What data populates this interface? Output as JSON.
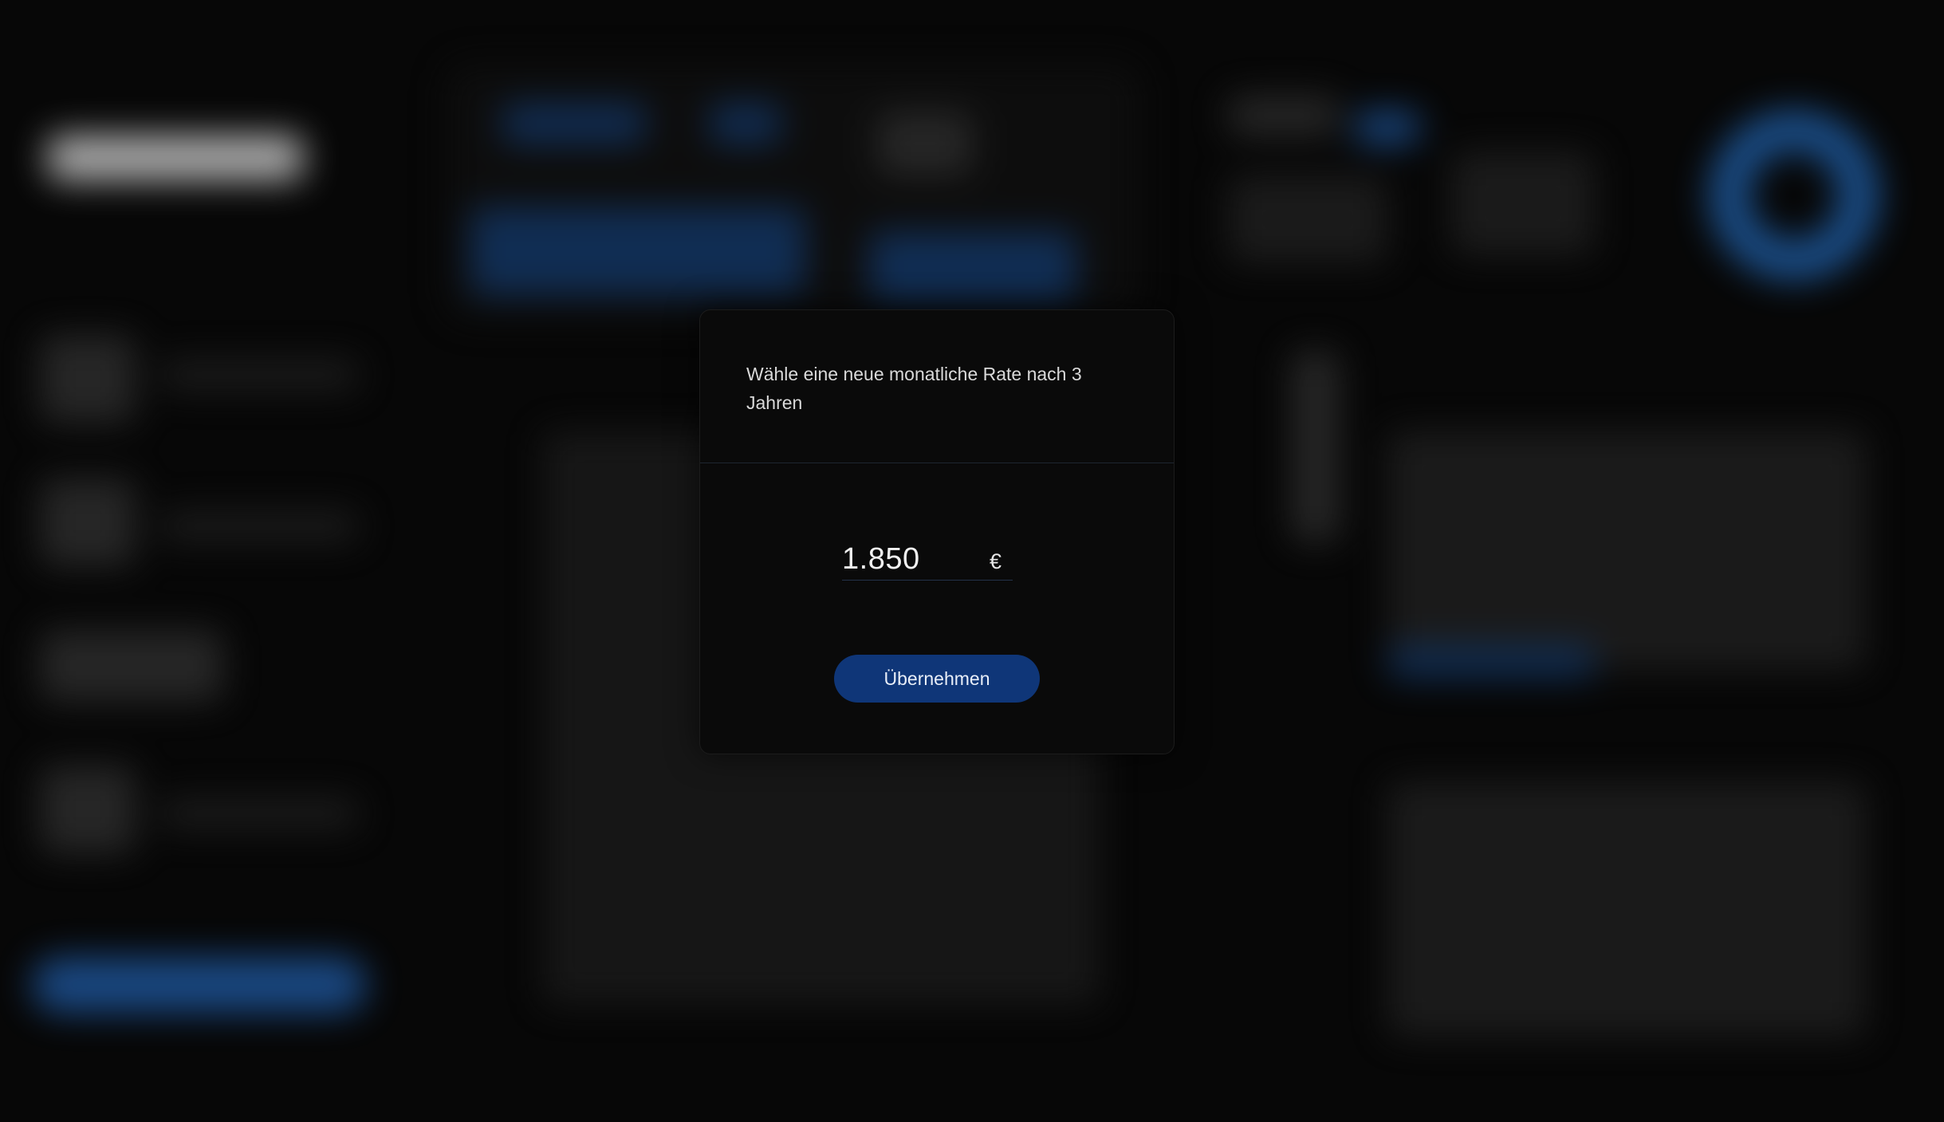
{
  "modal": {
    "prompt": "Wähle eine neue monatliche Rate nach 3 Jahren",
    "rate_value": "1.850",
    "currency_symbol": "€",
    "apply_label": "Übernehmen"
  },
  "theme": {
    "background": "#070707",
    "modal_background": "#0a0a0a",
    "accent_button": "#0f3678",
    "background_accent": "#1f5ea6"
  }
}
